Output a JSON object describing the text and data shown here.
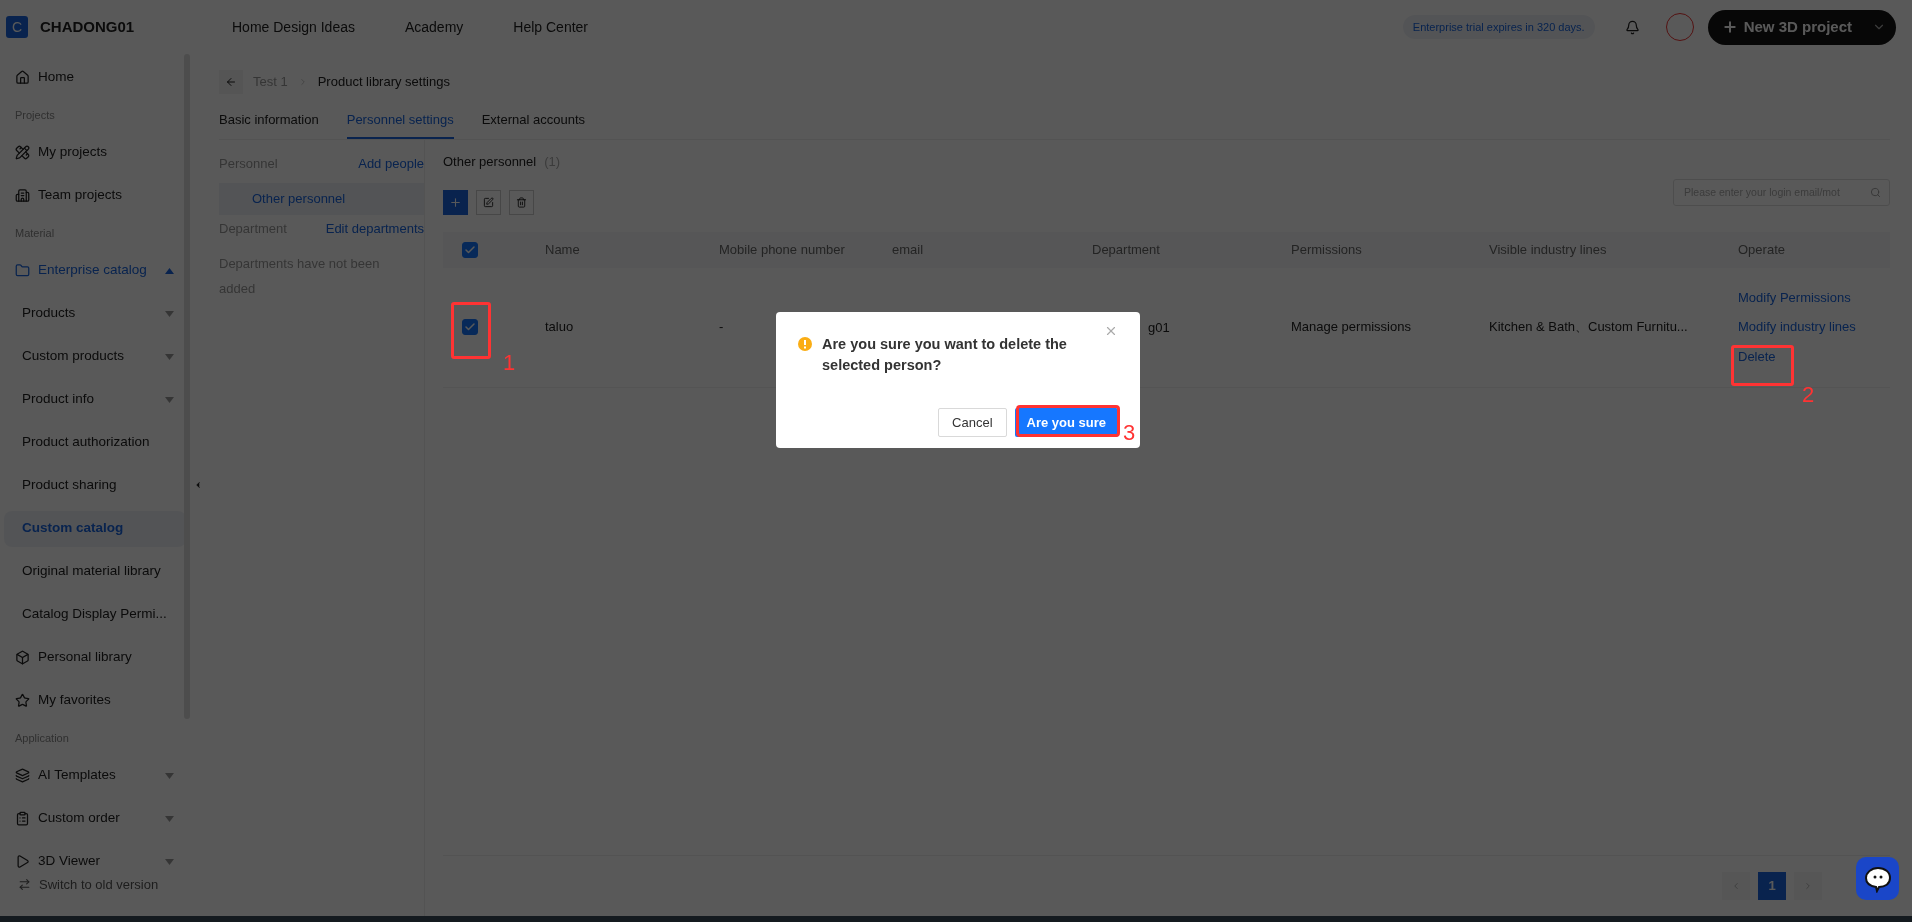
{
  "header": {
    "logo_letter": "C",
    "brand": "CHADONG01",
    "nav": [
      "Home Design Ideas",
      "Academy",
      "Help Center"
    ],
    "trial": "Enterprise trial expires in 320 days.",
    "new_project": "New 3D project"
  },
  "sidebar": {
    "items": [
      {
        "kind": "item",
        "label": "Home",
        "selected": false
      },
      {
        "kind": "section",
        "label": "Projects"
      },
      {
        "kind": "item",
        "label": "My projects",
        "selected": false
      },
      {
        "kind": "item",
        "label": "Team projects",
        "selected": false
      },
      {
        "kind": "section",
        "label": "Material"
      },
      {
        "kind": "item",
        "label": "Enterprise catalog",
        "selected": false,
        "active": true,
        "expanded": true
      },
      {
        "kind": "sub",
        "label": "Products",
        "selected": false,
        "expanded": false
      },
      {
        "kind": "sub",
        "label": "Custom products",
        "selected": false,
        "expanded": false
      },
      {
        "kind": "sub",
        "label": "Product info",
        "selected": false,
        "expanded": false
      },
      {
        "kind": "sub",
        "label": "Product authorization",
        "selected": false
      },
      {
        "kind": "sub",
        "label": "Product sharing",
        "selected": false
      },
      {
        "kind": "sub",
        "label": "Custom catalog",
        "selected": true
      },
      {
        "kind": "sub",
        "label": "Original material library",
        "selected": false
      },
      {
        "kind": "sub",
        "label": "Catalog Display Permi...",
        "selected": false
      },
      {
        "kind": "item",
        "label": "Personal library",
        "selected": false
      },
      {
        "kind": "item",
        "label": "My favorites",
        "selected": false
      },
      {
        "kind": "section",
        "label": "Application"
      },
      {
        "kind": "item",
        "label": "AI Templates",
        "selected": false,
        "expanded": false
      },
      {
        "kind": "item",
        "label": "Custom order",
        "selected": false,
        "expanded": false
      },
      {
        "kind": "item",
        "label": "3D Viewer",
        "selected": false,
        "expanded": false
      }
    ],
    "switch": "Switch to old version"
  },
  "breadcrumb": [
    "Test 1",
    "Product library settings"
  ],
  "tabs": [
    {
      "label": "Basic information",
      "selected": false
    },
    {
      "label": "Personnel settings",
      "selected": true
    },
    {
      "label": "External accounts",
      "selected": false
    }
  ],
  "personnel_panel": {
    "personnel_label": "Personnel",
    "add_people": "Add people",
    "groups": [
      {
        "label": "Other personnel",
        "selected": true
      }
    ],
    "department_label": "Department",
    "edit_departments": "Edit departments",
    "empty": "Departments have not been added"
  },
  "list": {
    "title": "Other personnel",
    "count": "(1)",
    "search": {
      "placeholder": "Please enter your login email/mot"
    },
    "all_checked": true,
    "columns": [
      "Name",
      "Mobile phone number",
      "email",
      "Department",
      "Permissions",
      "Visible industry lines",
      "Operate"
    ],
    "rows": [
      {
        "checked": true,
        "name": "taluo",
        "mobile": "-",
        "department": "g01",
        "permissions": "Manage permissions",
        "industry_lines": "Kitchen & Bath、Custom Furnitu...",
        "actions": [
          "Modify Permissions",
          "Modify industry lines",
          "Delete"
        ]
      }
    ]
  },
  "pagination": {
    "pages": [
      {
        "label": "1",
        "selected": true
      }
    ]
  },
  "dialog": {
    "message": "Are you sure you want to delete the selected person?",
    "cancel": "Cancel",
    "confirm": "Are you sure"
  },
  "annotations": [
    {
      "label": "1"
    },
    {
      "label": "2"
    },
    {
      "label": "3"
    }
  ]
}
